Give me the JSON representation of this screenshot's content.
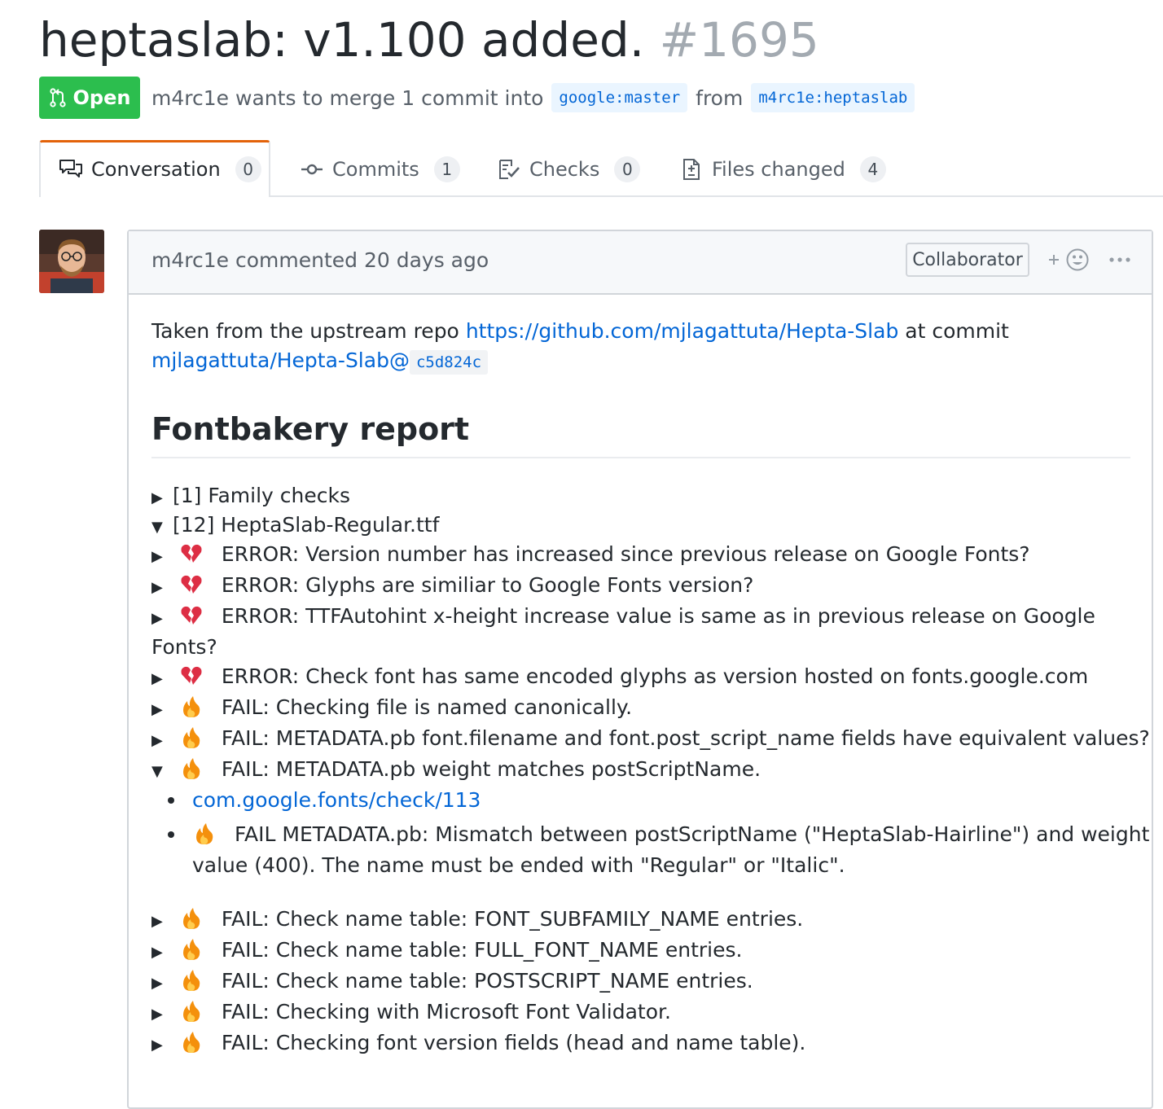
{
  "pr": {
    "title": "heptaslab: v1.100 added.",
    "number": "#1695",
    "state_label": "Open",
    "author": "m4rc1e",
    "merge_text": "wants to merge 1 commit into",
    "base_branch": "google:master",
    "from_word": "from",
    "head_branch": "m4rc1e:heptaslab",
    "state_color": "#2cbe4e"
  },
  "tabs": [
    {
      "label": "Conversation",
      "count": "0",
      "icon": "comment-discussion-icon"
    },
    {
      "label": "Commits",
      "count": "1",
      "icon": "git-commit-icon"
    },
    {
      "label": "Checks",
      "count": "0",
      "icon": "checklist-icon"
    },
    {
      "label": "Files changed",
      "count": "4",
      "icon": "file-diff-icon"
    }
  ],
  "comment": {
    "author": "m4rc1e",
    "action_time": "commented 20 days ago",
    "role_badge": "Collaborator",
    "intro_text": "Taken from the upstream repo",
    "repo_link": "https://github.com/mjlagattuta/Hepta-Slab",
    "at_commit_text": "at commit",
    "commit_repo_link": "mjlagattuta/Hepta-Slab@",
    "commit_sha": "c5d824c",
    "report_title": "Fontbakery report"
  },
  "report": {
    "family_checks": "[1] Family checks",
    "file_section": "[12] HeptaSlab-Regular.ttf",
    "items": [
      {
        "level": "ERROR:",
        "text": "Version number has increased since previous release on Google Fonts?",
        "icon": "broken-heart-icon"
      },
      {
        "level": "ERROR:",
        "text": "Glyphs are similiar to Google Fonts version?",
        "icon": "broken-heart-icon"
      },
      {
        "level": "ERROR:",
        "text": "TTFAutohint x-height increase value is same as in previous release on Google",
        "text_cont": "Fonts?",
        "icon": "broken-heart-icon"
      },
      {
        "level": "ERROR:",
        "text": "Check font has same encoded glyphs as version hosted on fonts.google.com",
        "icon": "broken-heart-icon"
      },
      {
        "level": "FAIL:",
        "text": "Checking file is named canonically.",
        "icon": "fire-icon"
      },
      {
        "level": "FAIL:",
        "text": "METADATA.pb font.filename and font.post_script_name fields have equivalent values?",
        "icon": "fire-icon"
      },
      {
        "level": "FAIL:",
        "text": "METADATA.pb weight matches postScriptName.",
        "icon": "fire-icon"
      },
      {
        "level": "FAIL:",
        "text": "Check name table: FONT_SUBFAMILY_NAME entries.",
        "icon": "fire-icon"
      },
      {
        "level": "FAIL:",
        "text": "Check name table: FULL_FONT_NAME entries.",
        "icon": "fire-icon"
      },
      {
        "level": "FAIL:",
        "text": "Check name table: POSTSCRIPT_NAME entries.",
        "icon": "fire-icon"
      },
      {
        "level": "FAIL:",
        "text": "Checking with Microsoft Font Validator.",
        "icon": "fire-icon"
      },
      {
        "level": "FAIL:",
        "text": "Checking font version fields (head and name table).",
        "icon": "fire-icon"
      }
    ],
    "expanded_detail": {
      "check_link": "com.google.fonts/check/113",
      "message_line1": "FAIL METADATA.pb: Mismatch between postScriptName (\"HeptaSlab-Hairline\") and weight",
      "message_line2": "value (400). The name must be ended with \"Regular\" or \"Italic\"."
    }
  }
}
